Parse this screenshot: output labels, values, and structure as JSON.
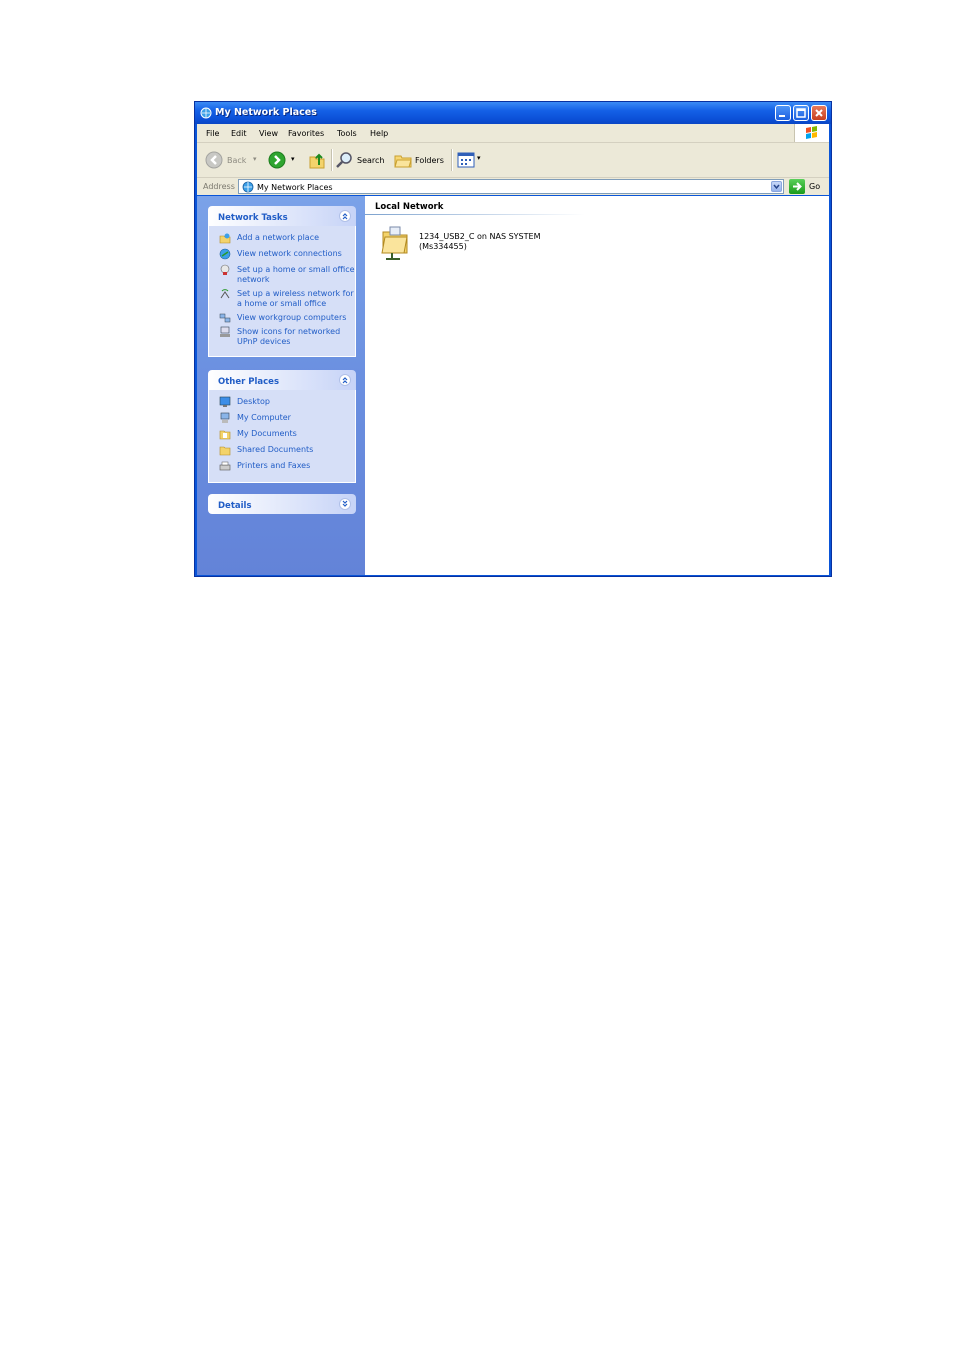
{
  "window": {
    "title": "My Network Places"
  },
  "menu": {
    "items": [
      "File",
      "Edit",
      "View",
      "Favorites",
      "Tools",
      "Help"
    ]
  },
  "toolbar": {
    "back_label": "Back",
    "search_label": "Search",
    "folders_label": "Folders"
  },
  "address": {
    "label": "Address",
    "value": "My Network Places",
    "go_label": "Go"
  },
  "network_tasks": {
    "title": "Network Tasks",
    "items": [
      {
        "label": "Add a network place",
        "icon": "add-network-place-icon"
      },
      {
        "label": "View network connections",
        "icon": "network-connections-icon"
      },
      {
        "label": "Set up a home or small office network",
        "icon": "home-network-setup-icon"
      },
      {
        "label": "Set up a wireless network for a home or small office",
        "icon": "wireless-network-icon"
      },
      {
        "label": "View workgroup computers",
        "icon": "workgroup-computers-icon"
      },
      {
        "label": "Show icons for networked UPnP devices",
        "icon": "upnp-devices-icon"
      }
    ]
  },
  "other_places": {
    "title": "Other Places",
    "items": [
      {
        "label": "Desktop",
        "icon": "desktop-icon"
      },
      {
        "label": "My Computer",
        "icon": "my-computer-icon"
      },
      {
        "label": "My Documents",
        "icon": "my-documents-icon"
      },
      {
        "label": "Shared Documents",
        "icon": "shared-documents-icon"
      },
      {
        "label": "Printers and Faxes",
        "icon": "printers-faxes-icon"
      }
    ]
  },
  "details": {
    "title": "Details"
  },
  "content": {
    "group_title": "Local Network",
    "items": [
      {
        "line1": "1234_USB2_C on NAS SYSTEM",
        "line2": "(Ms334455)"
      }
    ]
  },
  "colors": {
    "title_bar": "#0a55d8",
    "task_link": "#215dc6",
    "pane": "#6a8fe0"
  }
}
